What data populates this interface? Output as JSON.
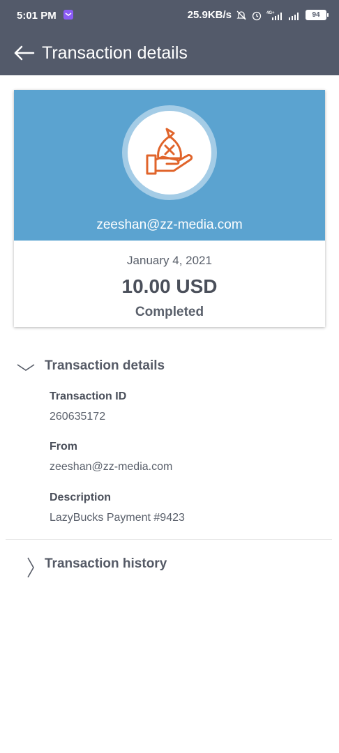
{
  "status_bar": {
    "time": "5:01 PM",
    "network_speed": "25.9KB/s",
    "battery": "94",
    "icons": [
      "message-icon",
      "mute-icon",
      "alarm-icon",
      "signal-4g-icon",
      "signal-icon",
      "battery-icon"
    ]
  },
  "header": {
    "title": "Transaction details",
    "back_icon": "back-arrow-icon"
  },
  "card": {
    "icon": "money-bag-hand-icon",
    "email": "zeeshan@zz-media.com",
    "date": "January 4, 2021",
    "amount": "10.00 USD",
    "status": "Completed",
    "colors": {
      "banner": "#5ba3d0",
      "icon_accent": "#e0642b"
    }
  },
  "details_section": {
    "title": "Transaction details",
    "expanded": true,
    "fields": [
      {
        "label": "Transaction ID",
        "value": "260635172"
      },
      {
        "label": "From",
        "value": "zeeshan@zz-media.com"
      },
      {
        "label": "Description",
        "value": "LazyBucks Payment #9423"
      }
    ]
  },
  "history_section": {
    "title": "Transaction history",
    "expanded": false
  },
  "colors": {
    "app_bar": "#535a6a"
  }
}
